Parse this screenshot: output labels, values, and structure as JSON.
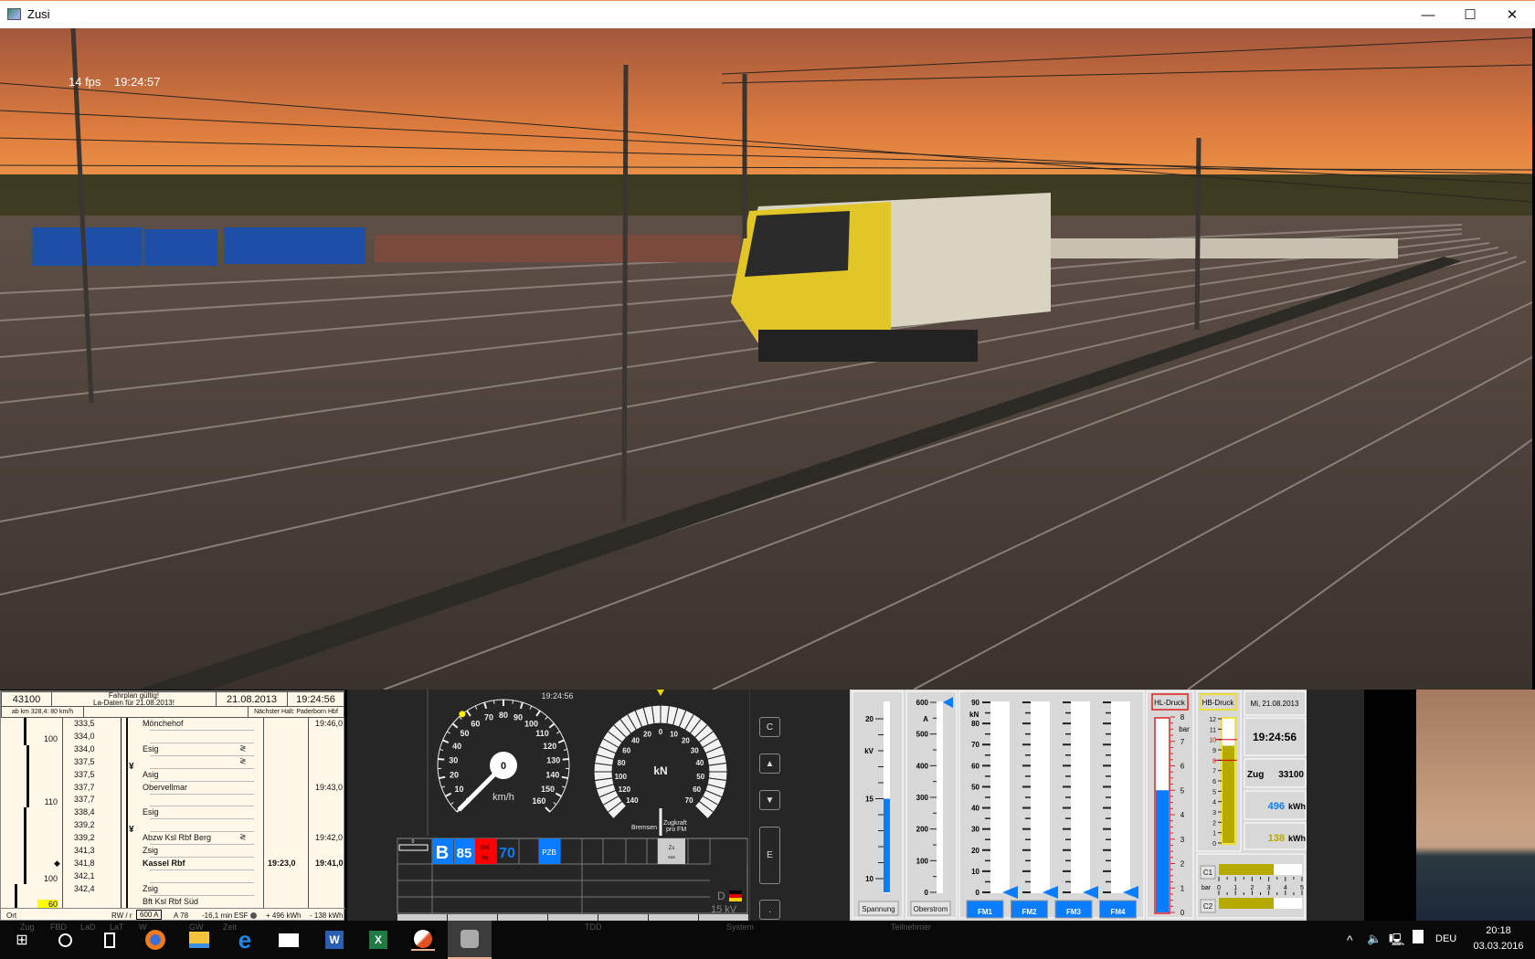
{
  "window": {
    "title": "Zusi",
    "minimize": "—",
    "maximize": "☐",
    "close": "✕"
  },
  "overlay": {
    "fps": "14 fps",
    "time": "19:24:57"
  },
  "timetable": {
    "train_number": "43100",
    "notice_line1": "Fahrplan gültig!",
    "notice_line2": "La-Daten für 21.08.2013!",
    "date": "21.08.2013",
    "time": "19:24:56",
    "speed_note": "ab km 328,4: 80 km/h",
    "next_stop": "Nächster Halt: Paderborn Hbf",
    "rows": [
      {
        "speed": "",
        "km": "333,5",
        "symbol": "",
        "station": "Mönchehof",
        "arr": "",
        "dep": "19:46,0",
        "wavy": false,
        "bold": false
      },
      {
        "speed": "100",
        "km": "334,0",
        "symbol": "",
        "station": "",
        "arr": "",
        "dep": "",
        "wavy": false,
        "bold": false
      },
      {
        "speed": "",
        "km": "334,0",
        "symbol": "",
        "station": "Esig",
        "arr": "",
        "dep": "",
        "wavy": true,
        "bold": false
      },
      {
        "speed": "",
        "km": "337,5",
        "symbol": "¥",
        "station": "",
        "arr": "",
        "dep": "",
        "wavy": true,
        "bold": false
      },
      {
        "speed": "",
        "km": "337,5",
        "symbol": "",
        "station": "Asig",
        "arr": "",
        "dep": "",
        "wavy": false,
        "bold": false
      },
      {
        "speed": "",
        "km": "337,7",
        "symbol": "",
        "station": "Obervellmar",
        "arr": "",
        "dep": "19:43,0",
        "wavy": false,
        "bold": false
      },
      {
        "speed": "110",
        "km": "337,7",
        "symbol": "",
        "station": "",
        "arr": "",
        "dep": "",
        "wavy": false,
        "bold": false
      },
      {
        "speed": "",
        "km": "338,4",
        "symbol": "",
        "station": "Esig",
        "arr": "",
        "dep": "",
        "wavy": false,
        "bold": false
      },
      {
        "speed": "",
        "km": "339,2",
        "symbol": "¥",
        "station": "",
        "arr": "",
        "dep": "",
        "wavy": false,
        "bold": false
      },
      {
        "speed": "",
        "km": "339,2",
        "symbol": "",
        "station": "Abzw Ksl Rbf Berg",
        "arr": "",
        "dep": "19:42,0",
        "wavy": true,
        "bold": false
      },
      {
        "speed": "",
        "km": "341,3",
        "symbol": "",
        "station": "Zsig",
        "arr": "",
        "dep": "",
        "wavy": false,
        "bold": false
      },
      {
        "speed": "",
        "km": "341,8",
        "symbol": "",
        "station": "Kassel Rbf",
        "arr": "19:23,0",
        "dep": "19:41,0",
        "wavy": false,
        "bold": true,
        "marker": "◆"
      },
      {
        "speed": "100",
        "km": "342,1",
        "symbol": "",
        "station": "",
        "arr": "",
        "dep": "",
        "wavy": false,
        "bold": false
      },
      {
        "speed": "",
        "km": "342,4",
        "symbol": "",
        "station": "Zsig",
        "arr": "",
        "dep": "",
        "wavy": false,
        "bold": false
      },
      {
        "speed": "60",
        "km": "",
        "symbol": "",
        "station": "Bft Ksl Rbf Süd",
        "arr": "",
        "dep": "",
        "wavy": false,
        "bold": false,
        "highlight": "#ffff00"
      }
    ],
    "footer": {
      "location": "Ort",
      "rw_label": "RW / r",
      "rw_value": "600 A",
      "a_value": "A 78",
      "delay": "-16,1 min",
      "esf": "ESF",
      "energy_plus": "+ 496 kWh",
      "energy_minus": "- 138 kWh"
    }
  },
  "display": {
    "clock": "19:24:56",
    "speedometer": {
      "unit": "km/h",
      "speed": 0,
      "speed_text": "0",
      "max": 160,
      "target_marker": 57,
      "labels": [
        "0",
        "10",
        "20",
        "30",
        "40",
        "50",
        "60",
        "70",
        "80",
        "90",
        "100",
        "110",
        "120",
        "130",
        "140",
        "150",
        "160"
      ]
    },
    "force_gauge": {
      "unit": "kN",
      "brake_labels": [
        "0",
        "20",
        "40",
        "60",
        "80",
        "100",
        "120",
        "140"
      ],
      "traction_labels": [
        "10",
        "20",
        "30",
        "40",
        "50",
        "60",
        "70"
      ],
      "brake_caption": "Bremsen",
      "traction_caption_1": "Zugkraft",
      "traction_caption_2": "pro FM",
      "value": 0
    },
    "lzb": {
      "mode": "B",
      "speed_1": "85",
      "freq_1": "500",
      "freq_2": "Hz",
      "speed_2": "70",
      "pzb": "PZB",
      "zs_1": "Zs",
      "zs_2": "sus",
      "bar_value": "0",
      "country": "D",
      "voltage": "15 kV",
      "colors": {
        "blue": "#0a7cff",
        "red": "#ff0000"
      }
    },
    "side_buttons": [
      "C",
      "▲",
      "▼",
      "E",
      "."
    ]
  },
  "instruments": {
    "voltage": {
      "unit": "kV",
      "labels": [
        "20",
        "15",
        "10"
      ],
      "value_kv": 15,
      "button": "Spannung"
    },
    "current": {
      "unit": "A",
      "labels": [
        "600",
        "500",
        "400",
        "300",
        "200",
        "100",
        "0"
      ],
      "max_marker_a": 600,
      "value_a": 0,
      "button": "Oberstrom"
    },
    "traction_motors": {
      "unit": "kN",
      "labels": [
        "90",
        "80",
        "70",
        "60",
        "50",
        "40",
        "30",
        "20",
        "10",
        "0"
      ],
      "values_kn": [
        0,
        0,
        0,
        0
      ],
      "buttons": [
        "FM1",
        "FM2",
        "FM3",
        "FM4"
      ]
    },
    "brake_pipe": {
      "title": "HL-Druck",
      "unit": "bar",
      "labels": [
        "8",
        "7",
        "6",
        "5",
        "4",
        "3",
        "2",
        "1",
        "0"
      ],
      "value_bar": 5.0
    },
    "main_reservoir": {
      "title": "HB-Druck",
      "labels": [
        "12",
        "11",
        "10",
        "9",
        "8",
        "7",
        "6",
        "5",
        "4",
        "3",
        "2",
        "1",
        "0"
      ],
      "value_bar": 9.4,
      "limits_bar": [
        8,
        10
      ]
    },
    "info": {
      "date": "Mi, 21.08.2013",
      "time": "19:24:56",
      "train_label": "Zug",
      "train_number": "33100",
      "energy_1": "496",
      "energy_2": "138",
      "energy_unit": "kWh"
    },
    "brake_cylinders": {
      "c1": "C1",
      "c2": "C2",
      "unit": "bar",
      "labels": [
        "0",
        "1",
        "2",
        "3",
        "4",
        "5"
      ],
      "c1_bar": 3.3,
      "c2_bar": 3.3
    }
  },
  "underlying_buttons": [
    "Zug",
    "FBD",
    "LaD",
    "LaT",
    "W",
    "GW",
    "Zeit",
    "TDD",
    "System",
    "Teilnehmer"
  ],
  "taskbar": {
    "apps": [
      "windows-start",
      "search",
      "task-view",
      "firefox",
      "file-explorer",
      "edge",
      "mail",
      "word",
      "excel",
      "zusi-editor",
      "zusi"
    ],
    "tray": {
      "language": "DEU",
      "time": "20:18",
      "date": "03.03.2016"
    }
  }
}
